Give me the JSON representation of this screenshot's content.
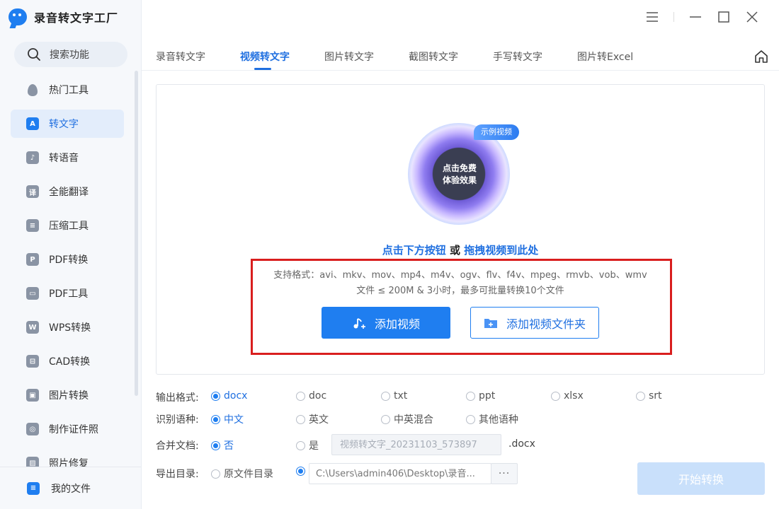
{
  "app": {
    "title": "录音转文字工厂",
    "logo_icon": "app-logo"
  },
  "sidebar": {
    "search_label": "搜索功能",
    "items": [
      {
        "label": "热门工具",
        "icon": "flame-icon",
        "active": false
      },
      {
        "label": "转文字",
        "icon": "text-convert-icon",
        "glyph": "A",
        "active": true
      },
      {
        "label": "转语音",
        "icon": "voice-icon",
        "glyph": "♪",
        "active": false
      },
      {
        "label": "全能翻译",
        "icon": "translate-icon",
        "glyph": "译",
        "active": false
      },
      {
        "label": "压缩工具",
        "icon": "compress-icon",
        "glyph": "≡",
        "active": false
      },
      {
        "label": "PDF转换",
        "icon": "pdf-convert-icon",
        "glyph": "P",
        "active": false
      },
      {
        "label": "PDF工具",
        "icon": "toolbox-icon",
        "glyph": "▭",
        "active": false
      },
      {
        "label": "WPS转换",
        "icon": "wps-icon",
        "glyph": "W",
        "active": false
      },
      {
        "label": "CAD转换",
        "icon": "cad-icon",
        "glyph": "⊟",
        "active": false
      },
      {
        "label": "图片转换",
        "icon": "image-convert-icon",
        "glyph": "▣",
        "active": false
      },
      {
        "label": "制作证件照",
        "icon": "id-photo-icon",
        "glyph": "◎",
        "active": false
      },
      {
        "label": "照片修复",
        "icon": "photo-repair-icon",
        "glyph": "▨",
        "active": false
      }
    ],
    "my_files": "我的文件"
  },
  "tabs": {
    "items": [
      "录音转文字",
      "视频转文字",
      "图片转文字",
      "截图转文字",
      "手写转文字",
      "图片转Excel"
    ],
    "active_index": 1
  },
  "dropzone": {
    "badge": "示例视频",
    "orb_line1": "点击免费",
    "orb_line2": "体验效果",
    "hint_link1": "点击下方按钮",
    "hint_or": " 或 ",
    "hint_link2": "拖拽视频到此处",
    "formats": "支持格式：avi、mkv、mov、mp4、m4v、ogv、flv、f4v、mpeg、rmvb、vob、wmv",
    "limits": "文件 ≤ 200M & 3小时，最多可批量转换10个文件",
    "add_video": "添加视频",
    "add_folder": "添加视频文件夹"
  },
  "options": {
    "output_format_label": "输出格式:",
    "output_formats": [
      {
        "label": "docx",
        "selected": true
      },
      {
        "label": "doc",
        "selected": false
      },
      {
        "label": "txt",
        "selected": false
      },
      {
        "label": "ppt",
        "selected": false
      },
      {
        "label": "xlsx",
        "selected": false
      },
      {
        "label": "srt",
        "selected": false
      }
    ],
    "language_label": "识别语种:",
    "languages": [
      {
        "label": "中文",
        "selected": true
      },
      {
        "label": "英文",
        "selected": false
      },
      {
        "label": "中英混合",
        "selected": false
      },
      {
        "label": "其他语种",
        "selected": false
      }
    ],
    "merge_label": "合并文档:",
    "merge_no": "否",
    "merge_yes": "是",
    "merge_filename_placeholder": "视频转文字_20231103_573897",
    "merge_ext": ".docx",
    "export_label": "导出目录:",
    "export_source_dir": "原文件目录",
    "export_path": "C:\\Users\\admin406\\Desktop\\录音...",
    "export_more": "···",
    "start_button": "开始转换"
  },
  "colors": {
    "accent": "#1f7ef0",
    "highlight_box": "#d91e1e",
    "start_disabled": "#c9e0fb"
  }
}
